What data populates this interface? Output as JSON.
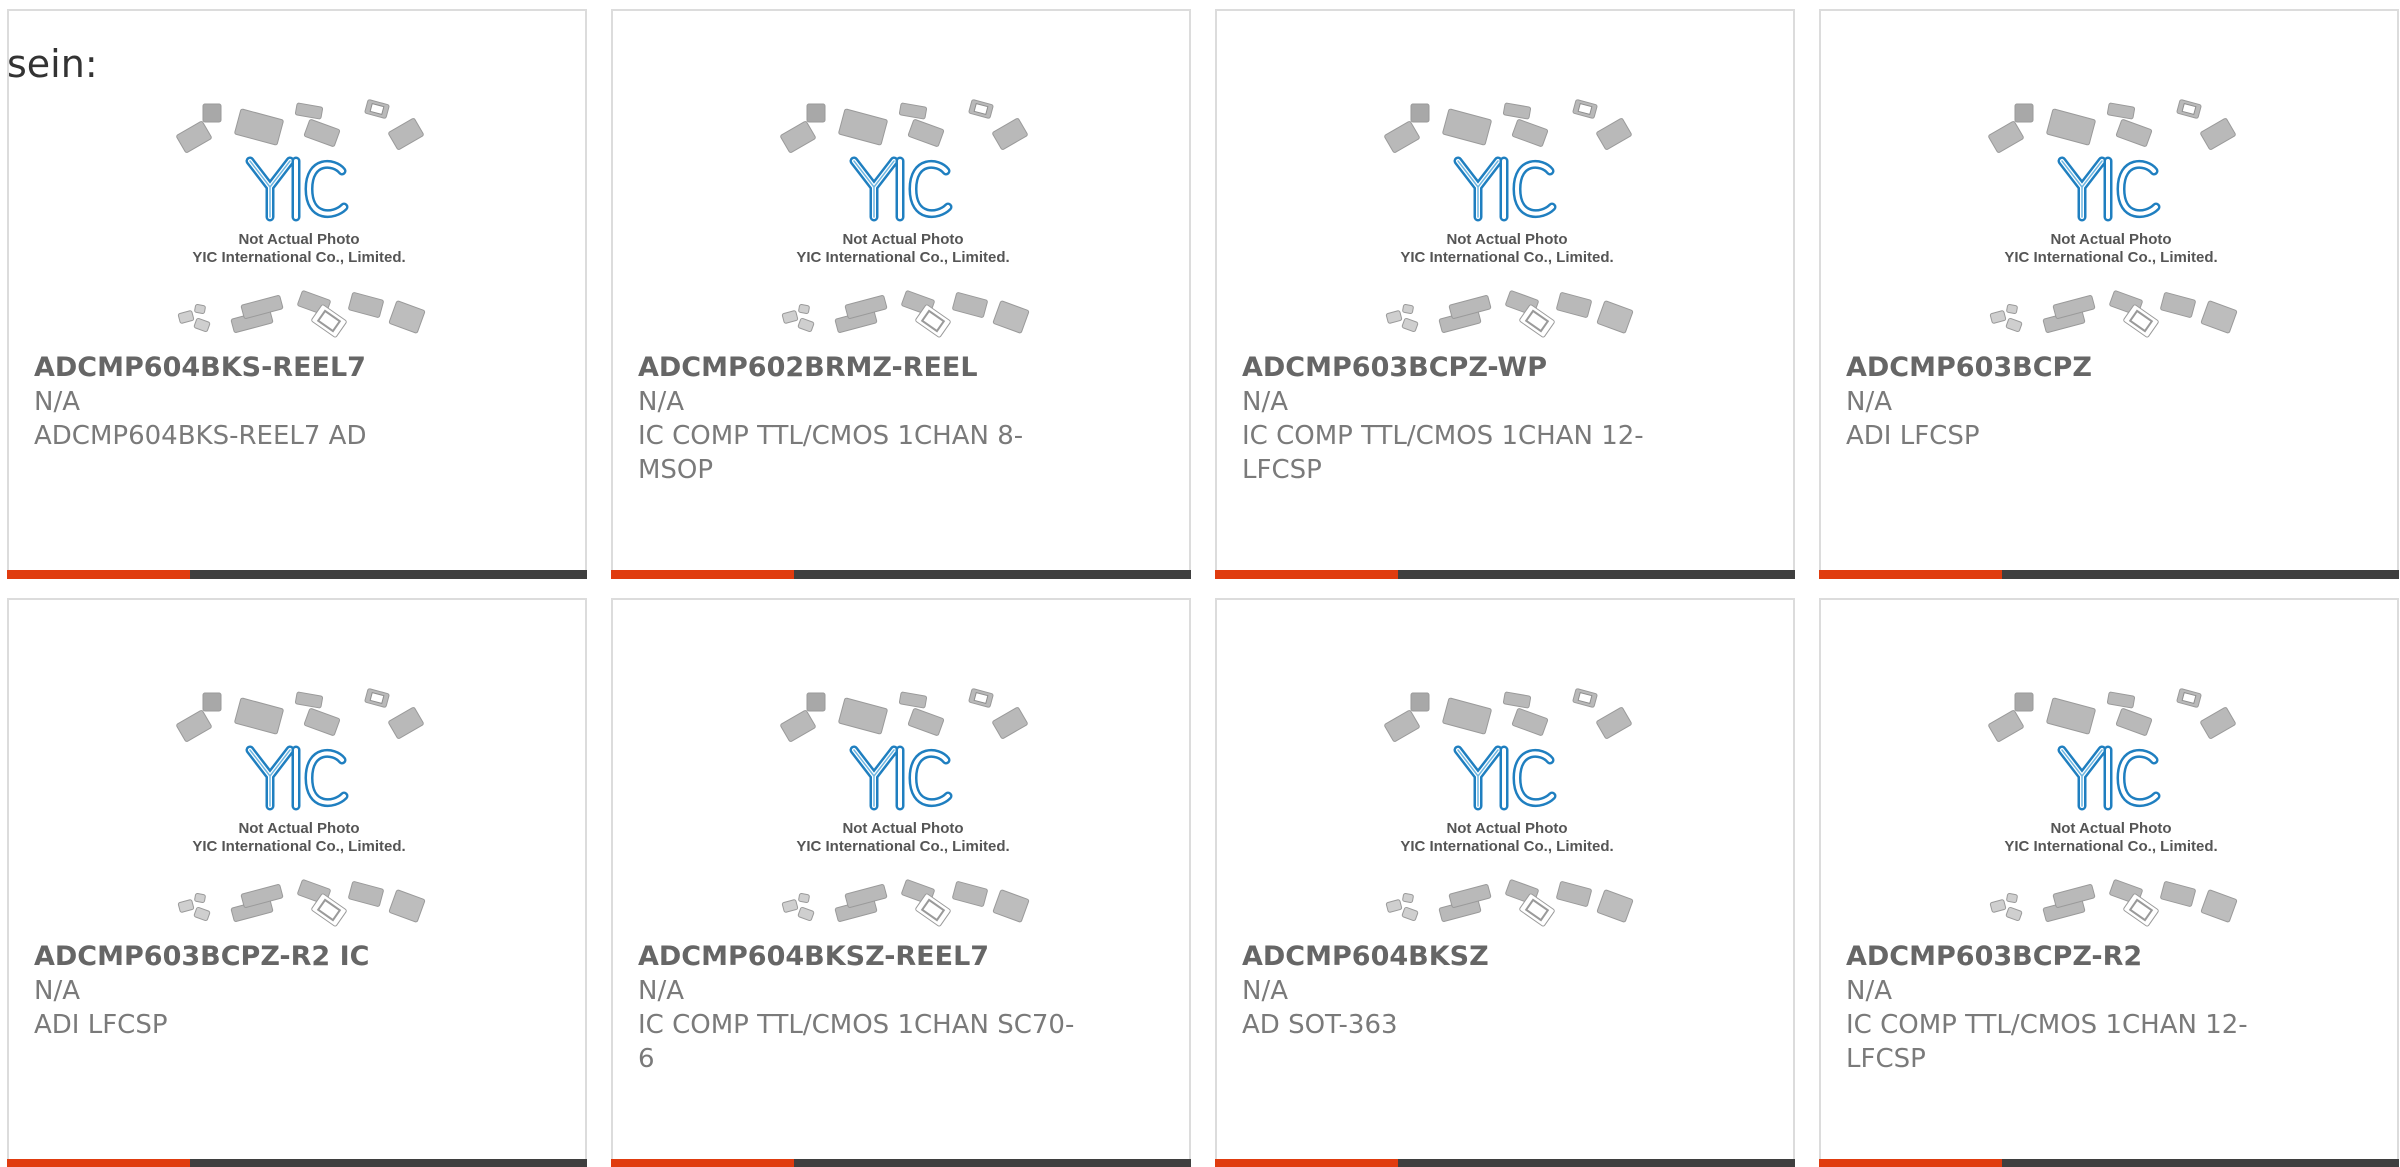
{
  "heading_fragment": "sein:",
  "placeholder": {
    "brand": "YIC",
    "caption_line1": "Not Actual Photo",
    "caption_line2": "YIC International Co., Limited."
  },
  "colors": {
    "accent": "#e03c0f",
    "bar": "#3f3f3f",
    "logo_blue": "#1f7fc0",
    "text": "#666666"
  },
  "products": [
    {
      "part": "ADCMP604BKS-REEL7",
      "manufacturer": "N/A",
      "description": "ADCMP604BKS-REEL7 AD"
    },
    {
      "part": "ADCMP602BRMZ-REEL",
      "manufacturer": "N/A",
      "description": "IC COMP TTL/CMOS 1CHAN 8-MSOP"
    },
    {
      "part": "ADCMP603BCPZ-WP",
      "manufacturer": "N/A",
      "description": "IC COMP TTL/CMOS 1CHAN 12-LFCSP"
    },
    {
      "part": "ADCMP603BCPZ",
      "manufacturer": "N/A",
      "description": "ADI LFCSP"
    },
    {
      "part": "ADCMP603BCPZ-R2 IC",
      "manufacturer": "N/A",
      "description": "ADI LFCSP"
    },
    {
      "part": "ADCMP604BKSZ-REEL7",
      "manufacturer": "N/A",
      "description": "IC COMP TTL/CMOS 1CHAN SC70-6"
    },
    {
      "part": "ADCMP604BKSZ",
      "manufacturer": "N/A",
      "description": "AD SOT-363"
    },
    {
      "part": "ADCMP603BCPZ-R2",
      "manufacturer": "N/A",
      "description": "IC COMP TTL/CMOS 1CHAN 12-LFCSP"
    }
  ]
}
